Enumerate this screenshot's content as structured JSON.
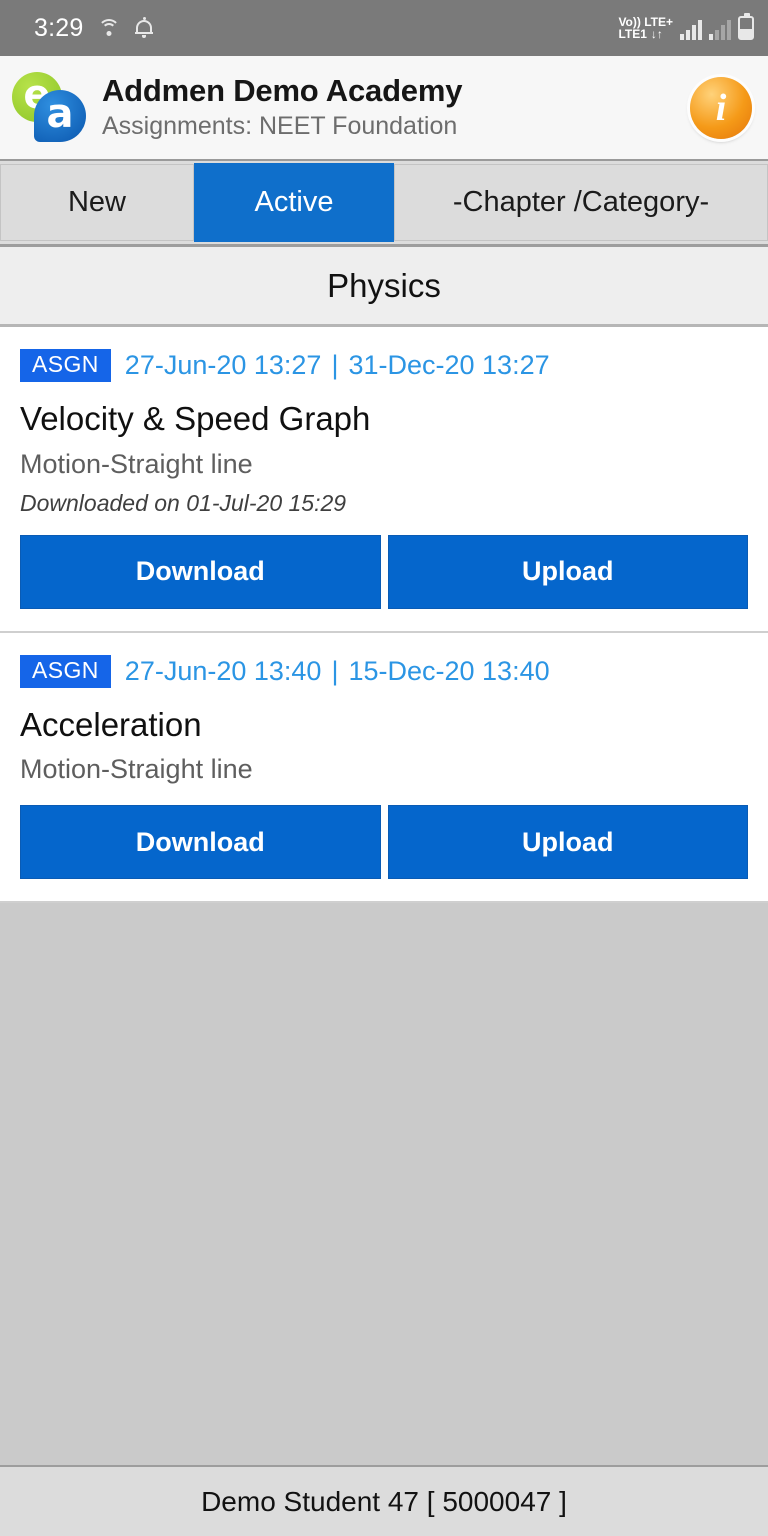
{
  "statusbar": {
    "clock": "3:29",
    "wifi_icon": "wifi-icon",
    "bell_icon": "bell-icon",
    "volte_line1": "Vo)) LTE+",
    "volte_line2": "LTE1",
    "data_arrows": "↓↑",
    "battery_icon": "battery-icon"
  },
  "header": {
    "logo_letter_1": "e",
    "logo_letter_2": "a",
    "title": "Addmen Demo Academy",
    "subtitle": "Assignments: NEET Foundation",
    "info_glyph": "i"
  },
  "tabs": {
    "selected": "Active",
    "items": [
      {
        "label": "New",
        "active": false
      },
      {
        "label": "Active",
        "active": true
      },
      {
        "label": "-Chapter /Category-",
        "active": false
      }
    ]
  },
  "subject": {
    "label": "Physics"
  },
  "assignments": [
    {
      "badge": "ASGN",
      "start_date": "27-Jun-20 13:27",
      "separator": "|",
      "end_date": "31-Dec-20 13:27",
      "title": "Velocity & Speed Graph",
      "chapter": "Motion-Straight line",
      "note": "Downloaded on 01-Jul-20 15:29",
      "download_label": "Download",
      "upload_label": "Upload"
    },
    {
      "badge": "ASGN",
      "start_date": "27-Jun-20 13:40",
      "separator": "|",
      "end_date": "15-Dec-20 13:40",
      "title": "Acceleration",
      "chapter": "Motion-Straight line",
      "note": "",
      "download_label": "Download",
      "upload_label": "Upload"
    }
  ],
  "footer": {
    "label": "Demo Student 47 [ 5000047 ]"
  },
  "colors": {
    "accent_blue": "#0566cc",
    "tab_active_blue": "#0f6fcb",
    "badge_blue": "#1565e8",
    "date_blue": "#2b95e4",
    "statusbar_gray": "#7a7a7a",
    "page_gray": "#cacaca",
    "footer_gray": "#dcdcdc"
  }
}
